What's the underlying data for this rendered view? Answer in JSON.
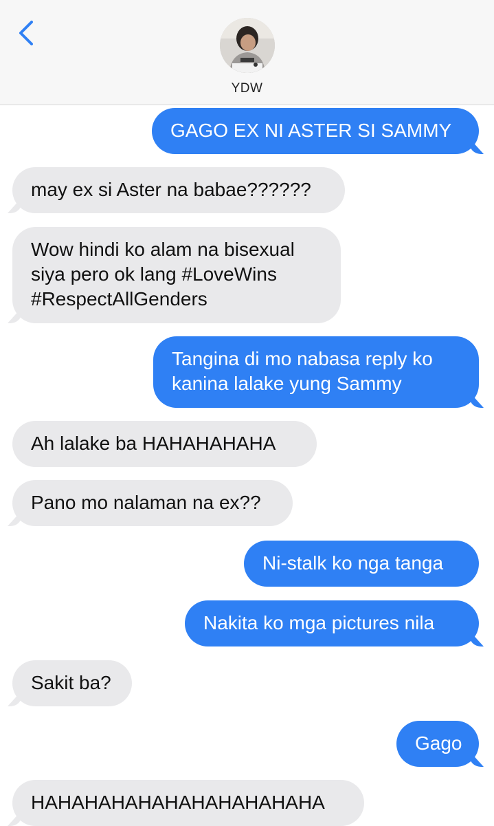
{
  "header": {
    "contact_name": "YDW",
    "accent_color": "#2f80f4"
  },
  "messages": [
    {
      "direction": "outgoing",
      "lines": [
        "GAGO EX NI ASTER SI SAMMY"
      ]
    },
    {
      "direction": "incoming",
      "lines": [
        "may ex si Aster na babae??????"
      ]
    },
    {
      "direction": "incoming",
      "lines": [
        "Wow hindi ko alam na bisexual",
        "siya pero ok lang #LoveWins",
        "#RespectAllGenders"
      ]
    },
    {
      "direction": "outgoing",
      "lines": [
        "Tangina di mo nabasa reply ko",
        "kanina lalake yung Sammy"
      ]
    },
    {
      "direction": "incoming",
      "lines": [
        "Ah lalake ba HAHAHAHAHA"
      ]
    },
    {
      "direction": "incoming",
      "lines": [
        "Pano mo nalaman na ex??"
      ]
    },
    {
      "direction": "outgoing",
      "lines": [
        "Ni-stalk ko nga tanga"
      ]
    },
    {
      "direction": "outgoing",
      "lines": [
        "Nakita ko mga pictures nila"
      ]
    },
    {
      "direction": "incoming",
      "lines": [
        "Sakit ba?"
      ]
    },
    {
      "direction": "outgoing",
      "lines": [
        "Gago"
      ]
    },
    {
      "direction": "incoming",
      "lines": [
        "HAHAHAHAHAHAHAHAHAHAHA"
      ]
    }
  ],
  "colors": {
    "outgoing_bubble": "#2f80f4",
    "incoming_bubble": "#e9e9eb",
    "header_background": "#f7f7f7"
  },
  "icons": {
    "back": "chevron-left-icon",
    "avatar": "contact-avatar-photo"
  }
}
